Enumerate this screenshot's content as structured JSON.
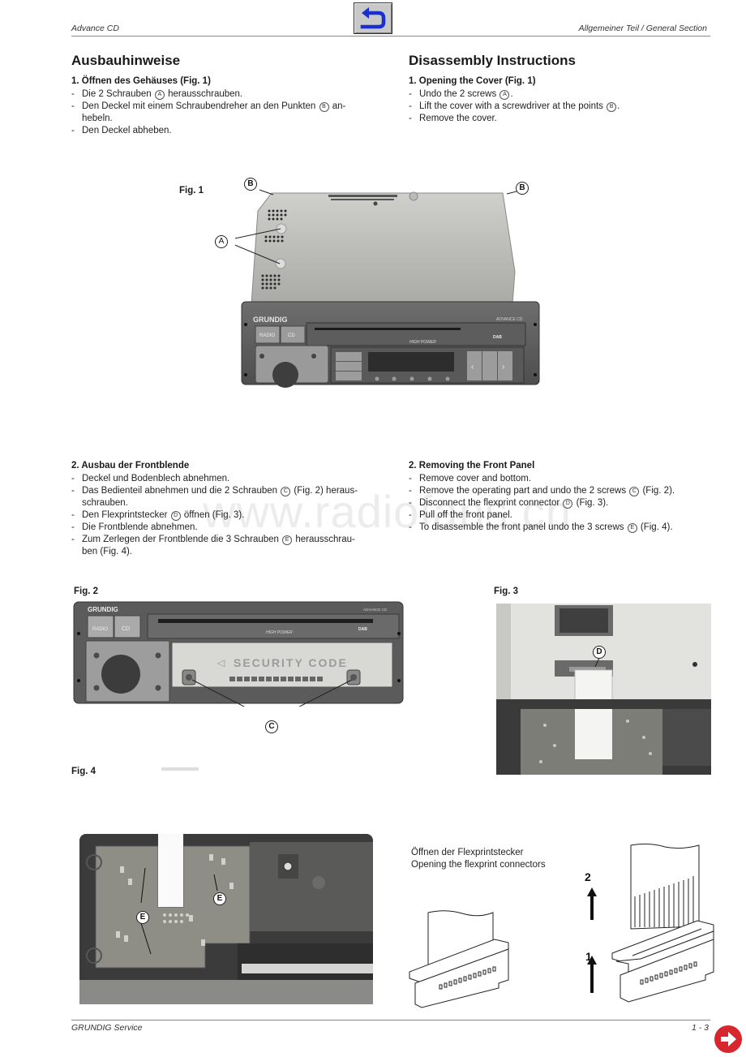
{
  "header": {
    "left": "Advance CD",
    "right": "Allgemeiner Teil / General Section",
    "back_button": "back-arrow-icon"
  },
  "german": {
    "title": "Ausbauhinweise",
    "section1": {
      "heading": "1. Öffnen des Gehäuses (Fig. 1)",
      "steps": [
        {
          "pre": "Die 2 Schrauben ",
          "mark": "A",
          "post": " herausschrauben."
        },
        {
          "pre": "Den Deckel mit einem Schraubendreher an den Punkten ",
          "mark": "B",
          "post": " an-hebeln."
        },
        {
          "pre": "Den Deckel abheben.",
          "mark": "",
          "post": ""
        }
      ]
    },
    "section2": {
      "heading": "2. Ausbau der Frontblende",
      "steps": [
        {
          "pre": "Deckel und Bodenblech abnehmen.",
          "mark": "",
          "post": ""
        },
        {
          "pre": "Das Bedienteil abnehmen und die 2 Schrauben ",
          "mark": "C",
          "post": " (Fig. 2) heraus-schrauben."
        },
        {
          "pre": "Den Flexprintstecker ",
          "mark": "D",
          "post": " öffnen (Fig. 3)."
        },
        {
          "pre": "Die Frontblende abnehmen.",
          "mark": "",
          "post": ""
        },
        {
          "pre": "Zum Zerlegen der Frontblende die 3 Schrauben ",
          "mark": "E",
          "post": " herausschrau-ben (Fig. 4)."
        }
      ]
    }
  },
  "english": {
    "title": "Disassembly Instructions",
    "section1": {
      "heading": "1. Opening the Cover (Fig. 1)",
      "steps": [
        {
          "pre": "Undo the 2 screws ",
          "mark": "A",
          "post": "."
        },
        {
          "pre": "Lift the cover with a screwdriver at the points ",
          "mark": "B",
          "post": "."
        },
        {
          "pre": "Remove the cover.",
          "mark": "",
          "post": ""
        }
      ]
    },
    "section2": {
      "heading": "2. Removing the Front Panel",
      "steps": [
        {
          "pre": "Remove cover and bottom.",
          "mark": "",
          "post": ""
        },
        {
          "pre": "Remove the operating part and undo the 2 screws ",
          "mark": "C",
          "post": " (Fig. 2)."
        },
        {
          "pre": "Disconnect the flexprint connector ",
          "mark": "D",
          "post": " (Fig. 3)."
        },
        {
          "pre": "Pull off the front panel.",
          "mark": "",
          "post": ""
        },
        {
          "pre": "To disassemble the front panel undo the 3 screws ",
          "mark": "E",
          "post": " (Fig. 4)."
        }
      ]
    }
  },
  "figures": {
    "fig1": {
      "label": "Fig. 1",
      "callouts": {
        "a": "A",
        "b": "B"
      },
      "brand": "GRUNDIG",
      "model": "ADVANCE CD",
      "buttons": [
        "RADIO",
        "CD"
      ],
      "panel_texts": [
        "HIGH POWER",
        "DAB"
      ]
    },
    "fig2": {
      "label": "Fig. 2",
      "callout": "C",
      "brand": "GRUNDIG",
      "model": "ADVANCE CD",
      "buttons": [
        "RADIO",
        "CD"
      ],
      "security_text": "SECURITY CODE",
      "panel_texts": [
        "HIGH POWER",
        "DAB"
      ]
    },
    "fig3": {
      "label": "Fig. 3",
      "callout": "D"
    },
    "fig4": {
      "label": "Fig. 4",
      "callout": "E"
    },
    "connector_diagram": {
      "caption_de": "Öffnen der Flexprintstecker",
      "caption_en": "Opening the flexprint connectors",
      "step1": "1",
      "step2": "2"
    }
  },
  "watermark": "www.radiofans.cn",
  "footer": {
    "left": "GRUNDIG Service",
    "right": "1 - 3",
    "next_button": "next-arrow-icon"
  },
  "colors": {
    "back_button_arrow": "#1a2fd0",
    "next_button": "#d7262e"
  }
}
